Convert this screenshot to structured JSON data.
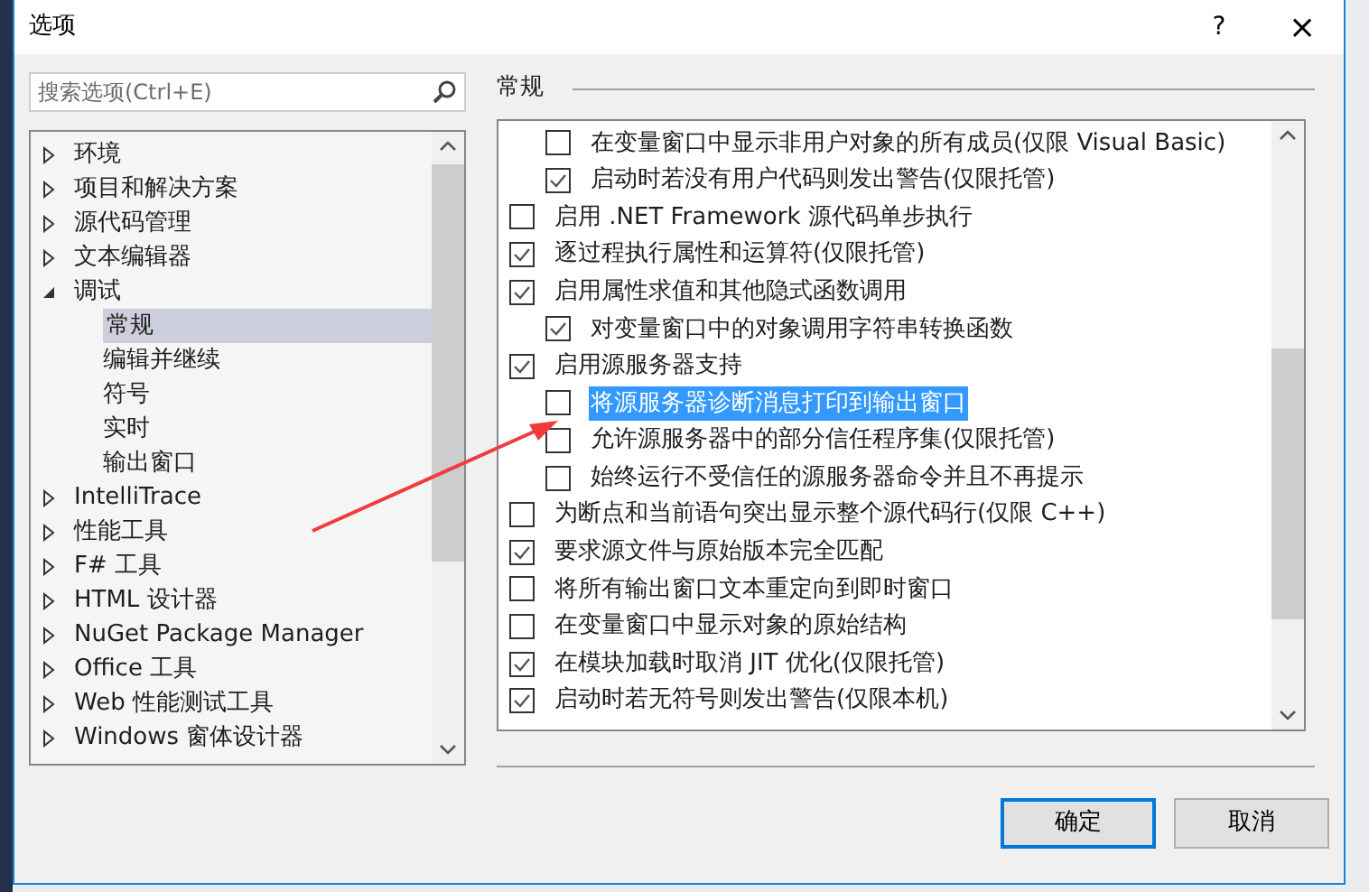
{
  "window": {
    "title": "选项",
    "help": "?",
    "close": "×"
  },
  "search": {
    "placeholder": "搜索选项(Ctrl+E)"
  },
  "tree": [
    {
      "label": "环境",
      "expanded": false,
      "selected": false
    },
    {
      "label": "项目和解决方案",
      "expanded": false,
      "selected": false
    },
    {
      "label": "源代码管理",
      "expanded": false,
      "selected": false
    },
    {
      "label": "文本编辑器",
      "expanded": false,
      "selected": false
    },
    {
      "label": "调试",
      "expanded": true,
      "selected": false,
      "children": [
        {
          "label": "常规",
          "selected": true
        },
        {
          "label": "编辑并继续",
          "selected": false
        },
        {
          "label": "符号",
          "selected": false
        },
        {
          "label": "实时",
          "selected": false
        },
        {
          "label": "输出窗口",
          "selected": false
        }
      ]
    },
    {
      "label": "IntelliTrace",
      "expanded": false,
      "selected": false
    },
    {
      "label": "性能工具",
      "expanded": false,
      "selected": false
    },
    {
      "label": "F# 工具",
      "expanded": false,
      "selected": false
    },
    {
      "label": "HTML 设计器",
      "expanded": false,
      "selected": false
    },
    {
      "label": "NuGet Package Manager",
      "expanded": false,
      "selected": false
    },
    {
      "label": "Office 工具",
      "expanded": false,
      "selected": false
    },
    {
      "label": "Web 性能测试工具",
      "expanded": false,
      "selected": false
    },
    {
      "label": "Windows 窗体设计器",
      "expanded": false,
      "selected": false
    }
  ],
  "section_title": "常规",
  "options": {
    "continued_children": [
      {
        "label": "在变量窗口中显示非用户对象的所有成员(仅限 Visual Basic)",
        "checked": false,
        "selected": false
      },
      {
        "label": "启动时若没有用户代码则发出警告(仅限托管)",
        "checked": true,
        "selected": false
      }
    ],
    "items": [
      {
        "label": "启用 .NET Framework 源代码单步执行",
        "checked": false,
        "selected": false
      },
      {
        "label": "逐过程执行属性和运算符(仅限托管)",
        "checked": true,
        "selected": false
      },
      {
        "label": "启用属性求值和其他隐式函数调用",
        "checked": true,
        "selected": false,
        "children": [
          {
            "label": "对变量窗口中的对象调用字符串转换函数",
            "checked": true,
            "selected": false
          }
        ]
      },
      {
        "label": "启用源服务器支持",
        "checked": true,
        "selected": false,
        "children": [
          {
            "label": "将源服务器诊断消息打印到输出窗口",
            "checked": false,
            "selected": true
          },
          {
            "label": "允许源服务器中的部分信任程序集(仅限托管)",
            "checked": false,
            "selected": false
          },
          {
            "label": "始终运行不受信任的源服务器命令并且不再提示",
            "checked": false,
            "selected": false
          }
        ]
      },
      {
        "label": "为断点和当前语句突出显示整个源代码行(仅限 C++)",
        "checked": false,
        "selected": false
      },
      {
        "label": "要求源文件与原始版本完全匹配",
        "checked": true,
        "selected": false
      },
      {
        "label": "将所有输出窗口文本重定向到即时窗口",
        "checked": false,
        "selected": false
      },
      {
        "label": "在变量窗口中显示对象的原始结构",
        "checked": false,
        "selected": false
      },
      {
        "label": "在模块加载时取消 JIT 优化(仅限托管)",
        "checked": true,
        "selected": false
      },
      {
        "label": "启动时若无符号则发出警告(仅限本机)",
        "checked": true,
        "selected": false
      }
    ]
  },
  "buttons": [
    {
      "label": "确定",
      "default": true
    },
    {
      "label": "取消",
      "default": false
    }
  ]
}
